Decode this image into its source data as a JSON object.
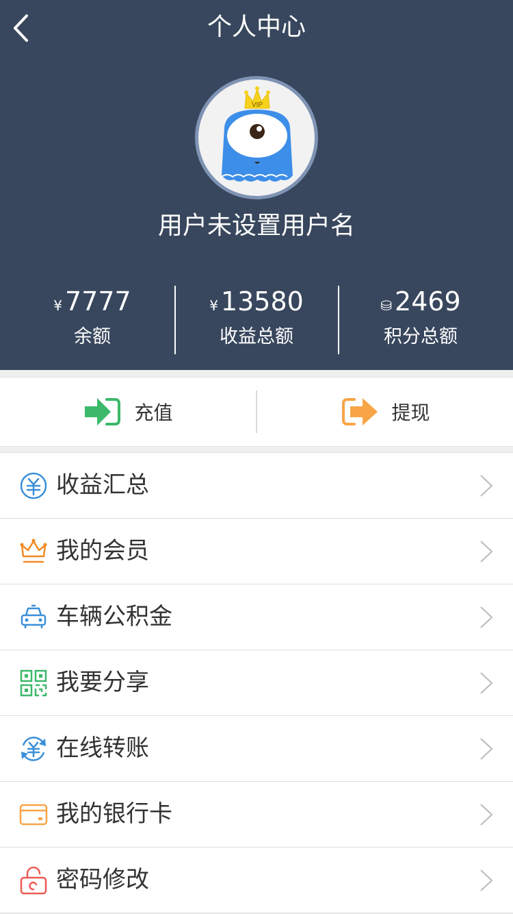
{
  "header": {
    "title": "个人中心",
    "background_color": "#38475d"
  },
  "profile": {
    "username": "用户未设置用户名",
    "avatar_badge": "VIP"
  },
  "stats": [
    {
      "unit": "¥",
      "value": "7777",
      "label": "余额",
      "icon": "yen-icon"
    },
    {
      "unit": "¥",
      "value": "13580",
      "label": "收益总额",
      "icon": "yen-icon"
    },
    {
      "unit": "⛁",
      "value": "2469",
      "label": "积分总额",
      "icon": "coins-icon"
    }
  ],
  "actions": {
    "recharge": {
      "label": "充值",
      "icon": "recharge-arrow-icon",
      "color": "#3cb96a"
    },
    "withdraw": {
      "label": "提现",
      "icon": "withdraw-arrow-icon",
      "color": "#f7a547"
    }
  },
  "menu": [
    {
      "label": "收益汇总",
      "icon": "yuan-circle-icon",
      "color": "#3a8fd9"
    },
    {
      "label": "我的会员",
      "icon": "crown-icon",
      "color": "#f08a24"
    },
    {
      "label": "车辆公积金",
      "icon": "car-icon",
      "color": "#3a8fd9"
    },
    {
      "label": "我要分享",
      "icon": "qr-code-icon",
      "color": "#3cb96a"
    },
    {
      "label": "在线转账",
      "icon": "transfer-icon",
      "color": "#3a8fd9"
    },
    {
      "label": "我的银行卡",
      "icon": "bank-card-icon",
      "color": "#f7a547"
    },
    {
      "label": "密码修改",
      "icon": "lock-icon",
      "color": "#ee5a55"
    }
  ]
}
